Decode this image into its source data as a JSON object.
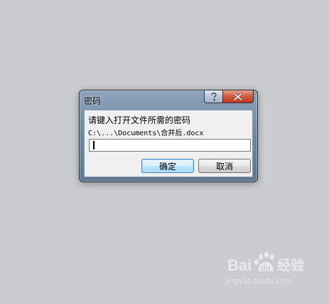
{
  "dialog": {
    "title": "密码",
    "prompt": "请键入打开文件所需的密码",
    "file_path": "C:\\...\\Documents\\合并后.docx",
    "password_value": "",
    "buttons": {
      "ok_label": "确定",
      "cancel_label": "取消"
    },
    "caption": {
      "help_icon": "question-mark-icon",
      "close_icon": "close-icon"
    }
  },
  "colors": {
    "desktop_background": "#caccd0",
    "close_button": "#c1381b",
    "default_button_border": "#3c7fb1"
  },
  "watermark": {
    "logo_text": "Bai du 经验",
    "url": "jingyan.baidu.com"
  }
}
